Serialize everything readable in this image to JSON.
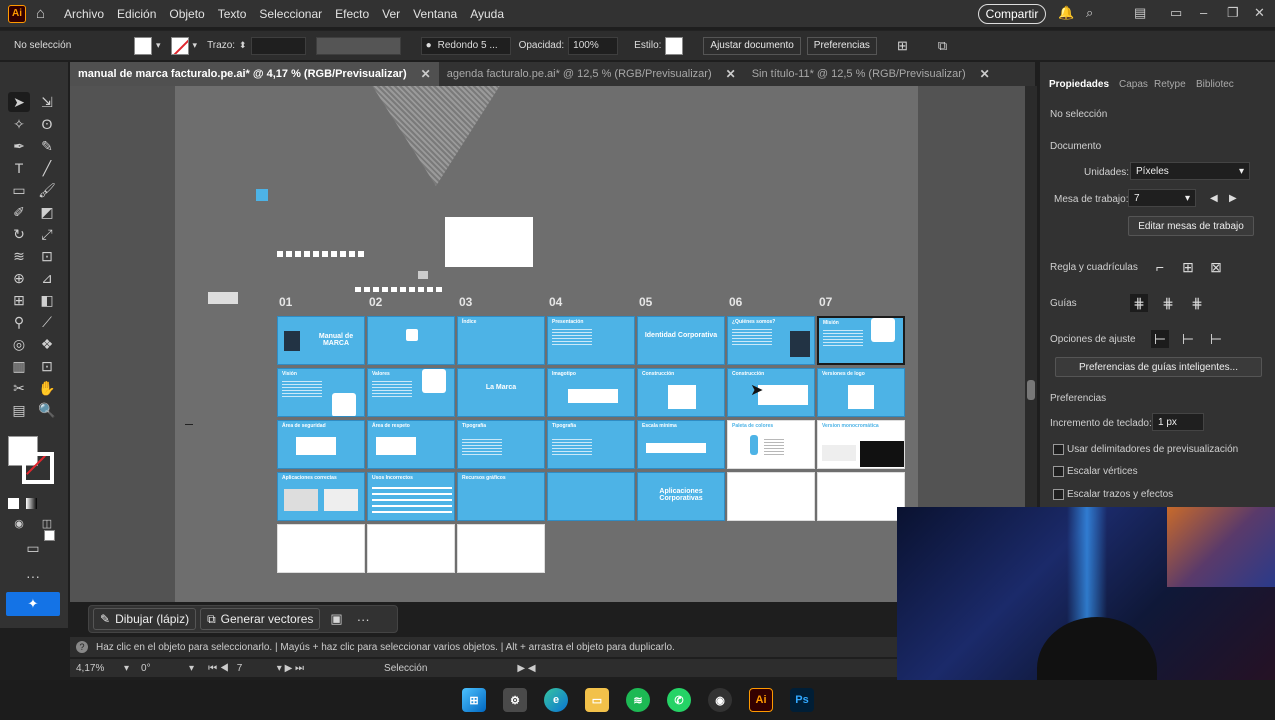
{
  "app": {
    "logo": "Ai"
  },
  "menu": {
    "items": [
      "Archivo",
      "Edición",
      "Objeto",
      "Texto",
      "Seleccionar",
      "Efecto",
      "Ver",
      "Ventana",
      "Ayuda"
    ],
    "share_label": "Compartir"
  },
  "control": {
    "selection": "No selección",
    "stroke_label": "Trazo:",
    "brush_label": "Redondo 5 ...",
    "opacity_label": "Opacidad:",
    "opacity_value": "100%",
    "style_label": "Estilo:",
    "adjust_doc": "Ajustar documento",
    "preferences": "Preferencias"
  },
  "tabs": [
    {
      "label": "manual de marca facturalo.pe.ai* @ 4,17 % (RGB/Previsualizar)"
    },
    {
      "label": "agenda facturalo.pe.ai* @ 12,5 % (RGB/Previsualizar)"
    },
    {
      "label": "Sin título-11* @ 12,5 % (RGB/Previsualizar)"
    }
  ],
  "canvas": {
    "columns": [
      "01",
      "02",
      "03",
      "04",
      "05",
      "06",
      "07"
    ],
    "rows": [
      [
        "Manual de MARCA",
        "",
        "Índice",
        "Presentación",
        "Identidad Corporativa",
        "¿Quiénes somos?",
        "Misión"
      ],
      [
        "Visión",
        "Valores",
        "La Marca",
        "Imagotipo",
        "Construcción",
        "Construcción",
        "Versiones de logo"
      ],
      [
        "Área de seguridad",
        "Área de respeto",
        "Tipografía",
        "Tipografía",
        "Escala mínima",
        "Paleta de colores",
        "Version monocromática"
      ],
      [
        "Aplicaciones correctas",
        "Usos Incorrectos",
        "Recursos gráficos",
        "",
        "Aplicaciones Corporativas",
        "",
        ""
      ],
      [
        "",
        "",
        "",
        "",
        "",
        "",
        ""
      ]
    ]
  },
  "context_bar": {
    "draw": "Dibujar (lápiz)",
    "generate": "Generar vectores"
  },
  "status": {
    "text": "Haz clic en el objeto para seleccionarlo.  |  Mayús + haz clic para seleccionar varios objetos.  |  Alt + arrastra el objeto para duplicarlo."
  },
  "bottom": {
    "zoom": "4,17%",
    "rotation": "0°",
    "artboard": "7",
    "mode": "Selección"
  },
  "panel": {
    "tabs": [
      "Propiedades",
      "Capas",
      "Retype",
      "Bibliotec"
    ],
    "no_selection": "No selección",
    "document": "Documento",
    "units_label": "Unidades:",
    "units_value": "Píxeles",
    "artboard_label": "Mesa de trabajo:",
    "artboard_value": "7",
    "edit_artboards": "Editar mesas de trabajo",
    "rulers": "Regla y cuadrículas",
    "guides": "Guías",
    "snap": "Opciones de ajuste",
    "smart_guides": "Preferencias de guías inteligentes...",
    "prefs": "Preferencias",
    "keyboard_inc_label": "Incremento de teclado:",
    "keyboard_inc_value": "1 px",
    "check1": "Usar delimitadores de previsualización",
    "check2": "Escalar vértices",
    "check3": "Escalar trazos y efectos"
  },
  "taskbar": {
    "items": [
      "windows-icon",
      "settings-icon",
      "edge-icon",
      "explorer-icon",
      "spotify-icon",
      "whatsapp-icon",
      "obs-icon",
      "illustrator-icon",
      "photoshop-icon"
    ]
  }
}
